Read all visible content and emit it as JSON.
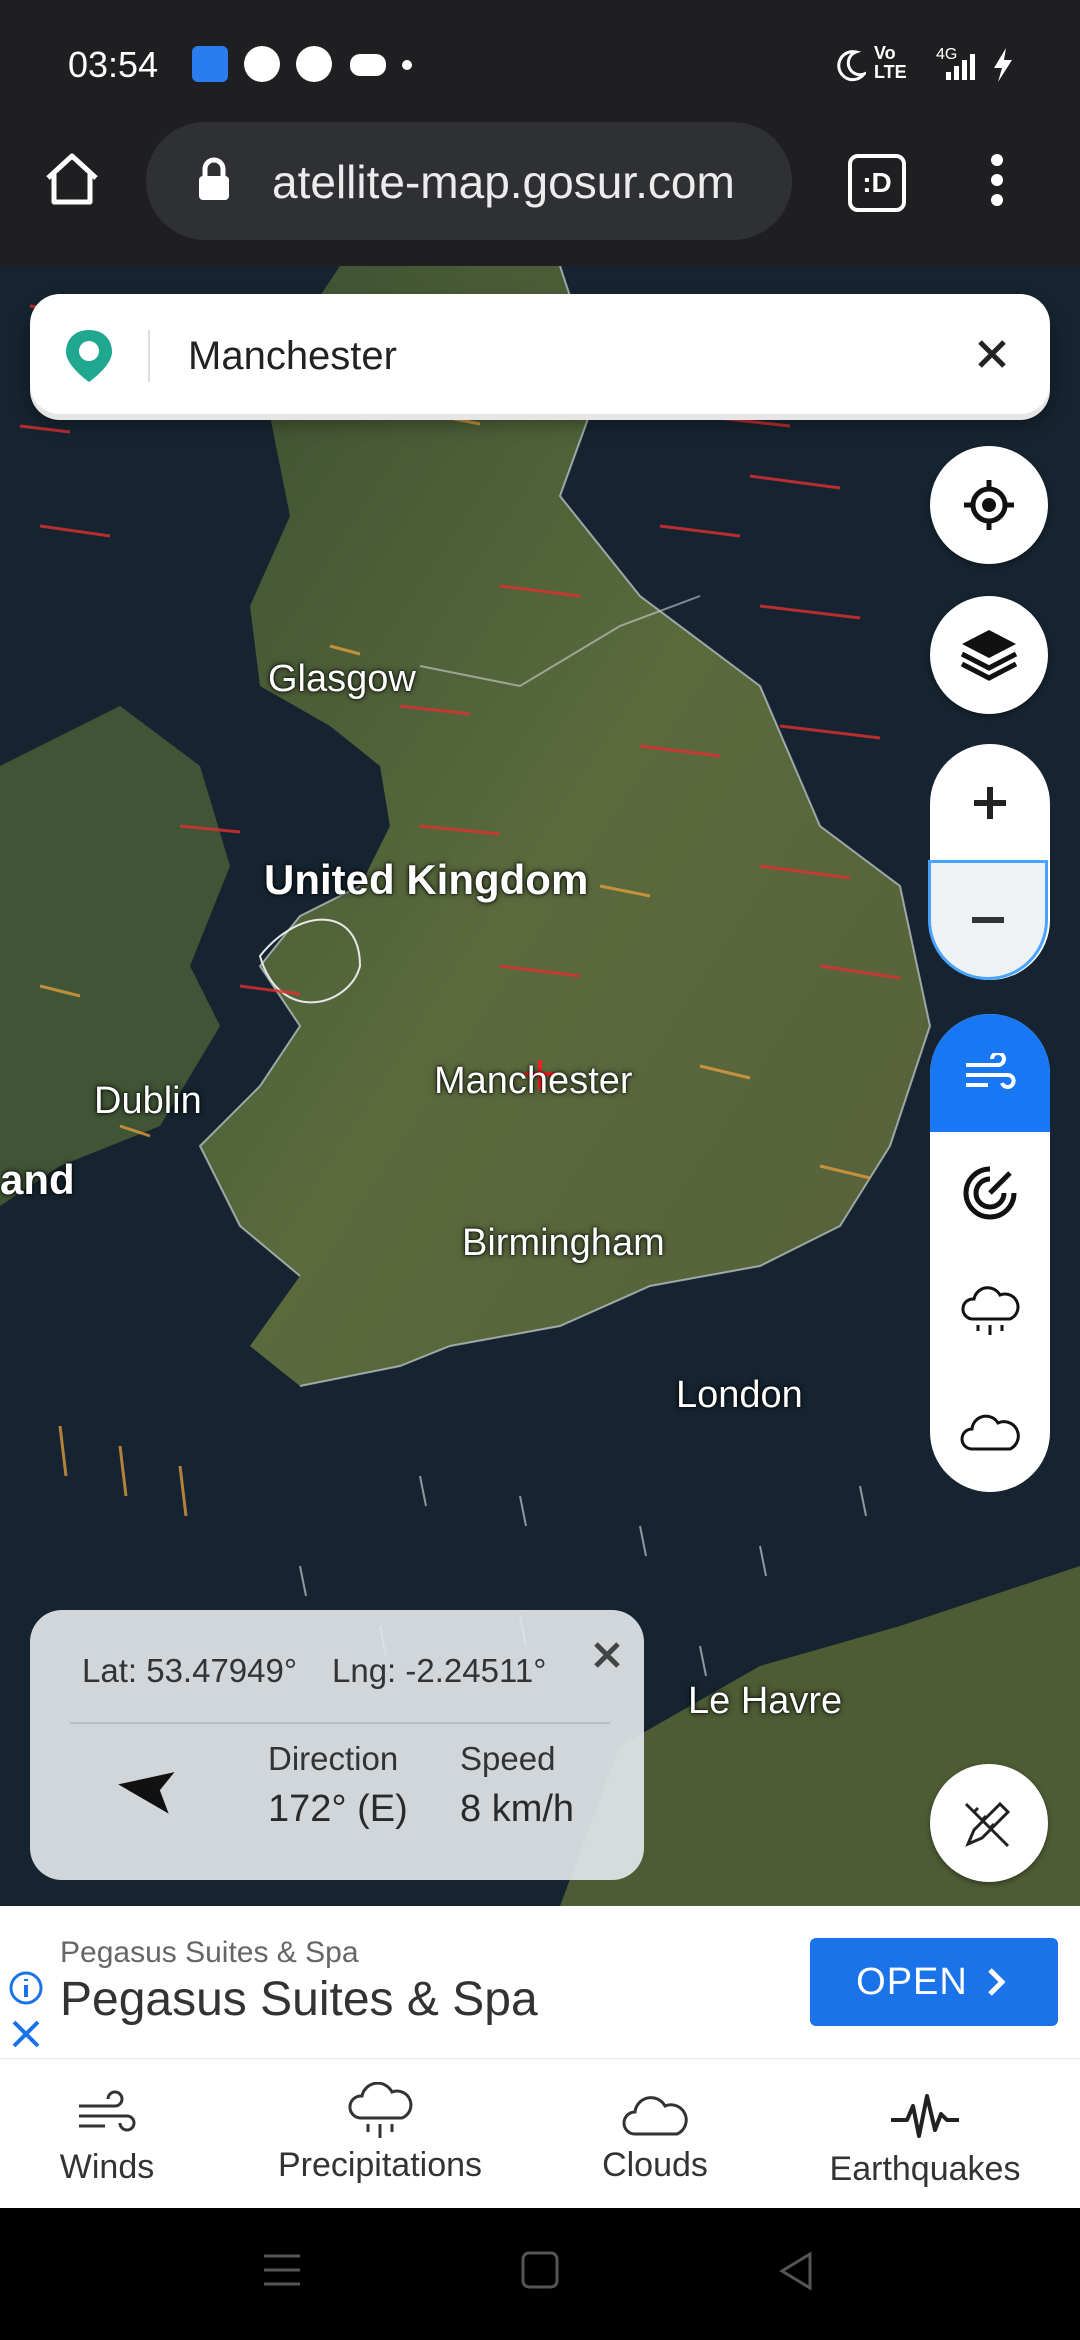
{
  "status_bar": {
    "time": "03:54",
    "left_icons": [
      "app-icon",
      "jio-icon",
      "app-grid-icon",
      "gamepad-icon",
      "dot-icon"
    ],
    "right_icons": [
      "moon-icon",
      "volte-icon",
      "signal-4g-icon",
      "charging-icon"
    ],
    "volte_label": "Vo LTE",
    "network_label": "4G"
  },
  "browser": {
    "url": "atellite-map.gosur.com",
    "tab_label": ":D"
  },
  "search": {
    "value": "Manchester"
  },
  "map": {
    "labels": {
      "glasgow": "Glasgow",
      "uk": "United Kingdom",
      "dublin": "Dublin",
      "ireland_partial": "and",
      "manchester": "Manchester",
      "birmingham": "Birmingham",
      "london": "London",
      "le_havre": "Le Havre"
    }
  },
  "info_panel": {
    "lat": "Lat: 53.47949°",
    "lng": "Lng: -2.24511°",
    "direction_label": "Direction",
    "direction_value": "172° (E)",
    "speed_label": "Speed",
    "speed_value": "8 km/h"
  },
  "ad": {
    "advertiser": "Pegasus Suites & Spa",
    "headline": "Pegasus Suites & Spa",
    "open_label": "OPEN"
  },
  "bottom_nav": [
    {
      "label": "Winds",
      "icon": "wind-icon"
    },
    {
      "label": "Precipitations",
      "icon": "rain-cloud-icon"
    },
    {
      "label": "Clouds",
      "icon": "cloud-icon"
    },
    {
      "label": "Earthquakes",
      "icon": "seismograph-icon"
    }
  ],
  "colors": {
    "accent": "#1a73e8",
    "layer_active": "#1877f2",
    "marker": "#1fa88f"
  }
}
